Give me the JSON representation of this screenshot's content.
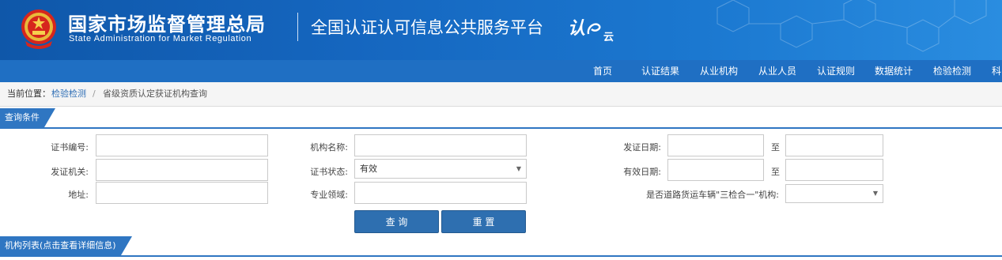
{
  "header": {
    "org_name_cn": "国家市场监督管理总局",
    "org_name_en": "State Administration  for  Market Regulation",
    "platform_title": "全国认证认可信息公共服务平台",
    "logo_text": "认",
    "logo_sub": "云"
  },
  "nav": {
    "items": [
      "首页",
      "认证结果",
      "从业机构",
      "从业人员",
      "认证规则",
      "数据统计",
      "检验检测",
      "科"
    ]
  },
  "breadcrumb": {
    "label": "当前位置：",
    "link": "检验检测",
    "separator": "/",
    "current": "省级资质认定获证机构查询"
  },
  "query_section": {
    "title": "查询条件"
  },
  "form": {
    "cert_no_label": "证书编号:",
    "cert_no_value": "",
    "issuer_label": "发证机关:",
    "issuer_value": "",
    "address_label": "地址:",
    "address_value": "",
    "org_name_label": "机构名称:",
    "org_name_value": "",
    "cert_status_label": "证书状态:",
    "cert_status_value": "有效",
    "field_label": "专业领域:",
    "field_value": "",
    "issue_date_label": "发证日期:",
    "issue_date_from": "",
    "issue_date_to_label": "至",
    "issue_date_to": "",
    "valid_date_label": "有效日期:",
    "valid_date_from": "",
    "valid_date_to_label": "至",
    "valid_date_to": "",
    "three_in_one_label": "是否道路货运车辆\"三检合一\"机构:",
    "three_in_one_value": ""
  },
  "buttons": {
    "query": "查 询",
    "reset": "重 置"
  },
  "list_section": {
    "title": "机构列表(点击查看详细信息)"
  },
  "colors": {
    "header_blue": "#1566bf",
    "nav_blue": "#1f6fc3",
    "accent": "#2f76c2",
    "button": "#2e6fb0"
  }
}
